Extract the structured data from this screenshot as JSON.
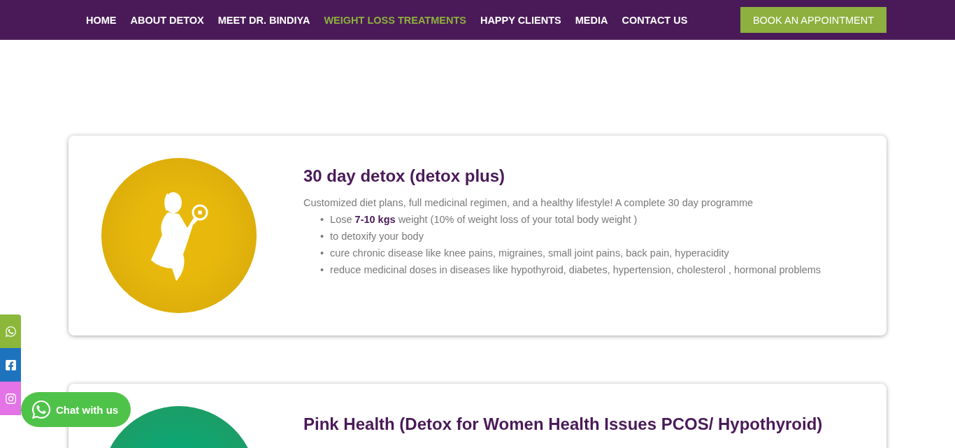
{
  "nav": {
    "items": [
      {
        "label": "HOME",
        "selected": false
      },
      {
        "label": "ABOUT DETOX",
        "selected": false
      },
      {
        "label": "MEET DR. BINDIYA",
        "selected": false
      },
      {
        "label": "WEIGHT LOSS TREATMENTS",
        "selected": true
      },
      {
        "label": "HAPPY CLIENTS",
        "selected": false
      },
      {
        "label": "MEDIA",
        "selected": false
      },
      {
        "label": "CONTACT US",
        "selected": false
      }
    ],
    "cta": "BOOK AN APPOINTMENT"
  },
  "cards": [
    {
      "title": "30 day detox (detox plus)",
      "color": "#e8b90c",
      "intro": "Customized diet plans, full medicinal regimen, and a healthy lifestyle! A complete 30 day programme",
      "bullets": [
        {
          "marker": "•",
          "text": "Lose **7-10 kgs** weight (10% of weight loss of your total body weight )"
        },
        {
          "marker": "•",
          "text": "to detoxify your body"
        },
        {
          "marker": "•",
          "text": "cure chronic disease like knee pains, migraines, small joint pains, back pain, hyperacidity"
        },
        {
          "marker": "•",
          "text": "reduce medicinal doses in diseases like hypothyroid, diabetes, hypertension, cholesterol , hormonal problems"
        }
      ]
    },
    {
      "title": "Pink Health (Detox for Women Health Issues PCOS/ Hypothyroid)",
      "color": "#0aa673"
    }
  ],
  "social": [
    {
      "kind": "whatsapp",
      "color": "#8bb83a"
    },
    {
      "kind": "facebook",
      "color": "#1e73be"
    },
    {
      "kind": "instagram",
      "color": "#e373e6"
    }
  ],
  "chat": {
    "label": "Chat with us"
  }
}
